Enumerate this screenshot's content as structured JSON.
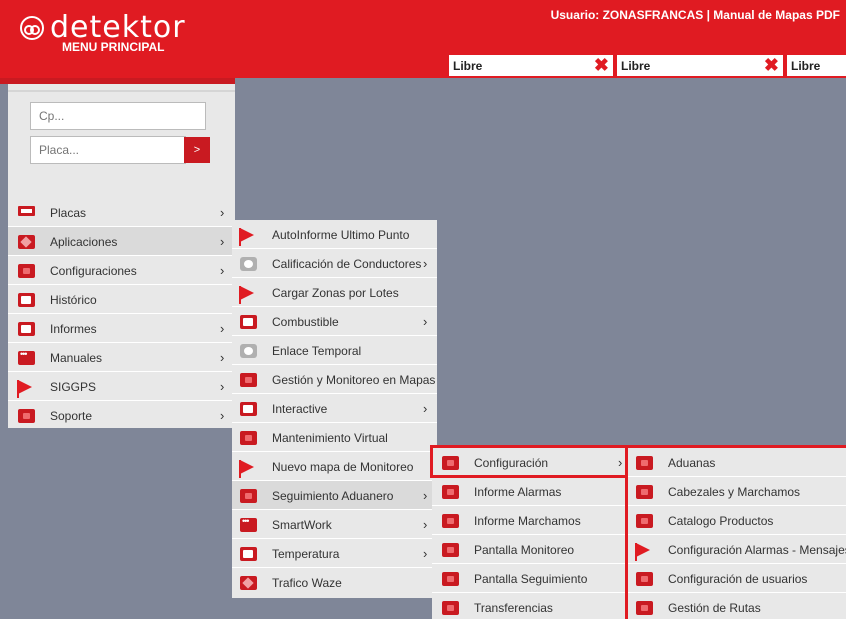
{
  "header": {
    "logo_text": "detektor",
    "menu_title": "MENU PRINCIPAL",
    "user_label": "Usuario: ZONASFRANCAS | ",
    "manual_link": "Manual de Mapas PDF"
  },
  "slots": [
    {
      "label": "Libre"
    },
    {
      "label": "Libre"
    },
    {
      "label": "Libre"
    }
  ],
  "search": {
    "cp_placeholder": "Cp...",
    "placa_placeholder": "Placa...",
    "go_label": ">"
  },
  "main_menu": [
    {
      "label": "Placas",
      "icon": "placa-icon",
      "has_sub": true
    },
    {
      "label": "Aplicaciones",
      "icon": "cube-icon",
      "has_sub": true
    },
    {
      "label": "Configuraciones",
      "icon": "app-icon",
      "has_sub": true
    },
    {
      "label": "Histórico",
      "icon": "document-icon",
      "has_sub": false
    },
    {
      "label": "Informes",
      "icon": "document-icon",
      "has_sub": true
    },
    {
      "label": "Manuales",
      "icon": "dots-icon",
      "has_sub": true
    },
    {
      "label": "SIGGPS",
      "icon": "flag-icon",
      "has_sub": true
    },
    {
      "label": "Soporte",
      "icon": "app-icon",
      "has_sub": true
    }
  ],
  "aplicaciones_menu": [
    {
      "label": "AutoInforme Ultimo Punto",
      "icon": "flag-icon",
      "has_sub": false
    },
    {
      "label": "Calificación de Conductores",
      "icon": "gear-icon",
      "has_sub": true
    },
    {
      "label": "Cargar Zonas por Lotes",
      "icon": "flag-icon",
      "has_sub": false
    },
    {
      "label": "Combustible",
      "icon": "document-icon",
      "has_sub": true
    },
    {
      "label": "Enlace Temporal",
      "icon": "gear-icon",
      "has_sub": false
    },
    {
      "label": "Gestión y Monitoreo en Mapas",
      "icon": "app-icon",
      "has_sub": false
    },
    {
      "label": "Interactive",
      "icon": "document-icon",
      "has_sub": true
    },
    {
      "label": "Mantenimiento Virtual",
      "icon": "app-icon",
      "has_sub": false
    },
    {
      "label": "Nuevo mapa de Monitoreo",
      "icon": "flag-icon",
      "has_sub": false
    },
    {
      "label": "Seguimiento Aduanero",
      "icon": "app-icon",
      "has_sub": true
    },
    {
      "label": "SmartWork",
      "icon": "dots-icon",
      "has_sub": true
    },
    {
      "label": "Temperatura",
      "icon": "document-icon",
      "has_sub": true
    },
    {
      "label": "Trafico Waze",
      "icon": "cube-icon",
      "has_sub": false
    }
  ],
  "seguimiento_menu": [
    {
      "label": "Configuración",
      "has_sub": true
    },
    {
      "label": "Informe Alarmas",
      "has_sub": false
    },
    {
      "label": "Informe Marchamos",
      "has_sub": false
    },
    {
      "label": "Pantalla Monitoreo",
      "has_sub": false
    },
    {
      "label": "Pantalla Seguimiento",
      "has_sub": false
    },
    {
      "label": "Transferencias",
      "has_sub": false
    }
  ],
  "configuracion_menu": [
    {
      "label": "Aduanas",
      "icon": "app-icon"
    },
    {
      "label": "Cabezales y Marchamos",
      "icon": "app-icon"
    },
    {
      "label": "Catalogo Productos",
      "icon": "app-icon"
    },
    {
      "label": "Configuración Alarmas - Mensajes",
      "icon": "flag-icon"
    },
    {
      "label": "Configuración de usuarios",
      "icon": "app-icon"
    },
    {
      "label": "Gestión de Rutas",
      "icon": "app-icon"
    }
  ],
  "chevron": "›",
  "colors": {
    "brand_red": "#e01b22",
    "menu_bg": "#e8e8e8",
    "canvas": "#7f8698"
  }
}
